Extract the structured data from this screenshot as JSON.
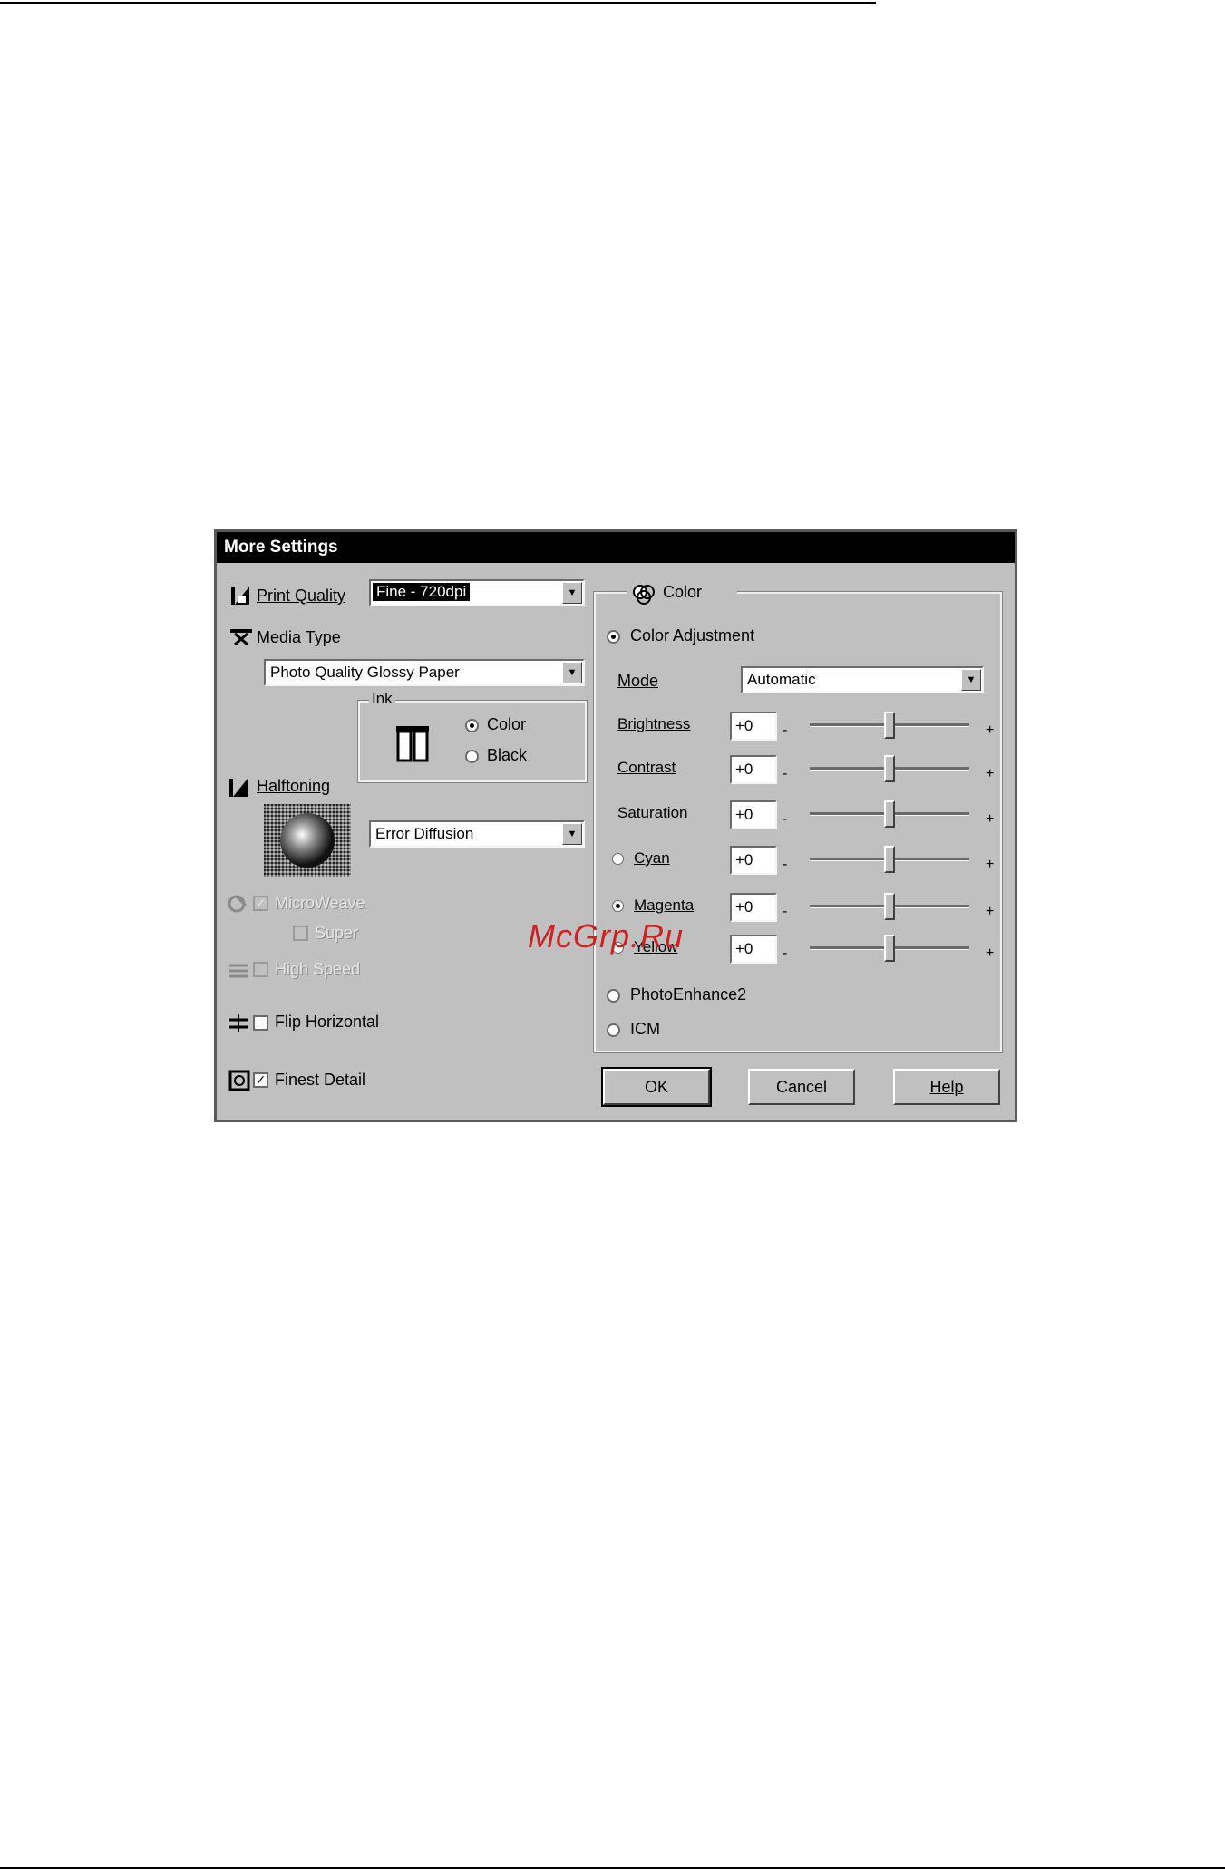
{
  "dialog": {
    "title": "More Settings",
    "print_quality": {
      "label": "Print Quality",
      "value": "Fine - 720dpi"
    },
    "media_type": {
      "label": "Media Type",
      "value": "Photo Quality Glossy Paper"
    },
    "ink": {
      "title": "Ink",
      "color": "Color",
      "black": "Black",
      "selected": "Color"
    },
    "halftoning": {
      "label": "Halftoning",
      "value": "Error Diffusion"
    },
    "microweave": {
      "label": "MicroWeave",
      "checked": true,
      "enabled": false
    },
    "super": {
      "label": "Super",
      "checked": false,
      "enabled": false
    },
    "high_speed": {
      "label": "High Speed",
      "checked": false,
      "enabled": false
    },
    "flip_horizontal": {
      "label": "Flip Horizontal",
      "checked": false
    },
    "finest_detail": {
      "label": "Finest Detail",
      "checked": true,
      "checkmark": "✓"
    },
    "color_group": {
      "title": "Color",
      "color_adjustment": "Color Adjustment",
      "mode": {
        "label": "Mode",
        "value": "Automatic"
      },
      "sliders": [
        {
          "label": "Brightness",
          "value": "+0",
          "level": 0.5
        },
        {
          "label": "Contrast",
          "value": "+0",
          "level": 0.5
        },
        {
          "label": "Saturation",
          "value": "+0",
          "level": 0.5
        },
        {
          "label": "Cyan",
          "value": "+0",
          "level": 0.5
        },
        {
          "label": "Magenta",
          "value": "+0",
          "level": 0.5
        },
        {
          "label": "Yellow",
          "value": "+0",
          "level": 0.5
        }
      ],
      "tick_minus": "-",
      "tick_plus": "+",
      "photo_enhance": "PhotoEnhance2",
      "icm": "ICM"
    },
    "buttons": {
      "ok": "OK",
      "cancel": "Cancel",
      "help": "Help"
    }
  },
  "watermark": "McGrp.Ru"
}
